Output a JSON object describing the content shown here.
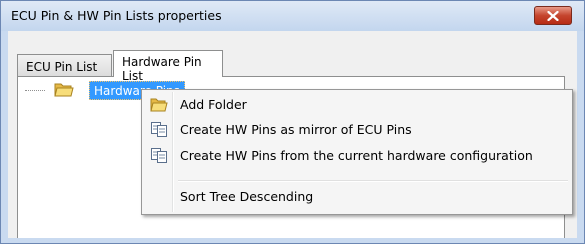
{
  "window": {
    "title": "ECU Pin & HW Pin Lists properties"
  },
  "tabs": [
    {
      "label": "ECU Pin List",
      "selected": false
    },
    {
      "label": "Hardware Pin List",
      "selected": true
    }
  ],
  "tree": {
    "root": {
      "label": "Hardware Pins",
      "icon": "folder-icon",
      "selected": true
    }
  },
  "context_menu": {
    "items": [
      {
        "label": "Add Folder",
        "icon": "folder-icon"
      },
      {
        "label": "Create HW Pins as mirror of ECU Pins",
        "icon": "copy-pages-icon"
      },
      {
        "label": "Create HW Pins from the current hardware configuration",
        "icon": "copy-pages-icon"
      },
      {
        "label": "Sort Tree Descending",
        "icon": ""
      }
    ]
  },
  "colors": {
    "selection": "#3399ff",
    "close_button": "#c5452e",
    "frame": "#c9daf0"
  }
}
